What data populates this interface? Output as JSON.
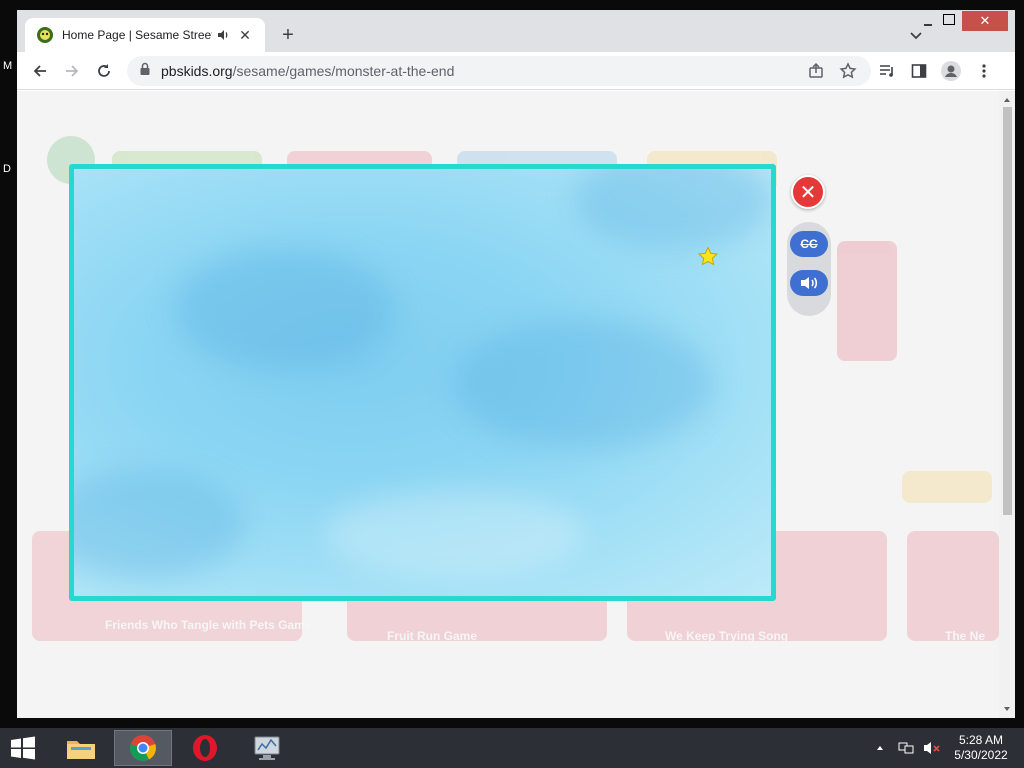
{
  "desktop": {
    "left_frag_1": "M",
    "left_frag_2": "D"
  },
  "browser": {
    "tab": {
      "title": "Home Page | Sesame Street |",
      "favicon": "pbs-kids-icon",
      "audio_icon": "speaker-icon",
      "close_label": "✕"
    },
    "new_tab_label": "+",
    "address": {
      "host": "pbskids.org",
      "path": "/sesame/games/monster-at-the-end"
    },
    "toolbar_icons": [
      "back-arrow-icon",
      "forward-arrow-icon",
      "reload-icon",
      "lock-icon",
      "share-icon",
      "star-bookmark-icon",
      "reading-list-icon",
      "side-panel-icon",
      "profile-icon",
      "kebab-menu-icon"
    ],
    "window_controls": {
      "close": "✕"
    }
  },
  "page": {
    "bg_labels": [
      "Friends Who Tangle with Pets Game",
      "Fruit Run Game",
      "We Keep Trying Song",
      "The Ne"
    ]
  },
  "game": {
    "close_label": "✕",
    "cc_label": "CC",
    "sound_icon": "speaker-icon",
    "frame_color": "#27d8cf"
  },
  "taskbar": {
    "apps": [
      "file-explorer-icon",
      "chrome-icon",
      "opera-icon",
      "network-monitor-icon"
    ],
    "clock": {
      "time": "5:28 AM",
      "date": "5/30/2022"
    }
  }
}
